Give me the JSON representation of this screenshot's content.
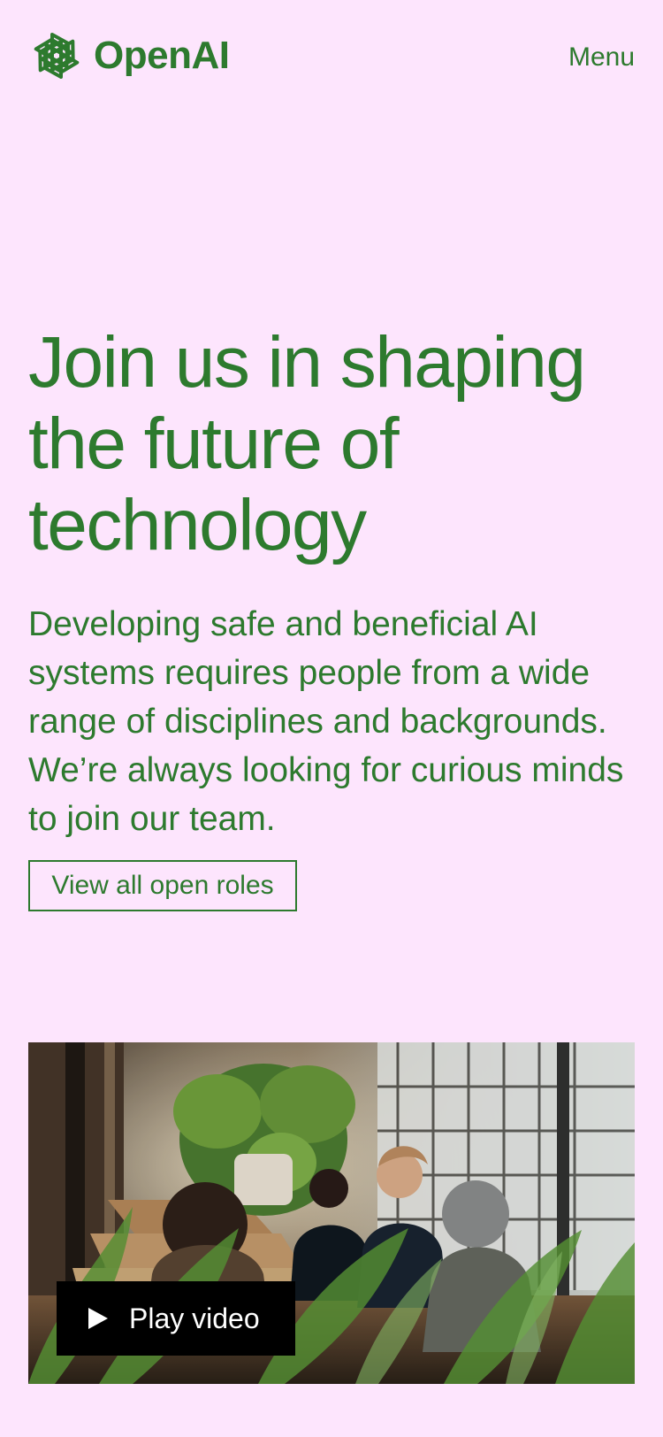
{
  "brand": {
    "name": "OpenAI",
    "logo_icon": "openai-knot-icon",
    "color": "#2d7a2e"
  },
  "header": {
    "menu_label": "Menu"
  },
  "hero": {
    "title": "Join us in shaping the future of technology",
    "description": "Developing safe and beneficial AI systems requires people from a wide range of disciplines and backgrounds. We’re always looking for curious minds to join our team.",
    "cta_label": "View all open roles"
  },
  "video": {
    "play_label": "Play video",
    "play_icon": "play-icon",
    "image_icon": "team-photo"
  },
  "colors": {
    "background": "#fde5fd",
    "text": "#2d7a2e",
    "button_bg": "#000000",
    "button_text": "#ffffff"
  }
}
